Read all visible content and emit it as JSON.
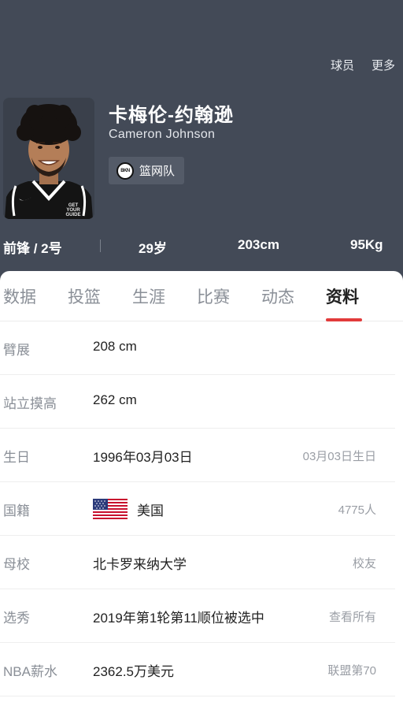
{
  "header": {
    "links": [
      "球员",
      "更多"
    ],
    "name_cn": "卡梅伦-约翰逊",
    "name_en": "Cameron Johnson",
    "team": {
      "logo_text": "BKN",
      "name": "篮网队"
    },
    "stats": {
      "position": "前锋 / 2号",
      "age": "29岁",
      "height": "203cm",
      "weight": "95Kg"
    },
    "jersey_text": "GET YOUR GUIDE"
  },
  "tabs": [
    {
      "label": "数据",
      "active": false
    },
    {
      "label": "投篮",
      "active": false
    },
    {
      "label": "生涯",
      "active": false
    },
    {
      "label": "比赛",
      "active": false
    },
    {
      "label": "动态",
      "active": false
    },
    {
      "label": "资料",
      "active": true
    }
  ],
  "profile": [
    {
      "label": "臂展",
      "value": "208 cm",
      "extra": ""
    },
    {
      "label": "站立摸高",
      "value": "262 cm",
      "extra": ""
    },
    {
      "label": "生日",
      "value": "1996年03月03日",
      "extra": "03月03日生日"
    },
    {
      "label": "国籍",
      "value": "美国",
      "extra": "4775人",
      "icon": "us-flag-icon"
    },
    {
      "label": "母校",
      "value": "北卡罗来纳大学",
      "extra": "校友"
    },
    {
      "label": "选秀",
      "value": "2019年第1轮第11顺位被选中",
      "extra": "查看所有"
    },
    {
      "label": "NBA薪水",
      "value": "2362.5万美元",
      "extra": "联盟第70"
    }
  ],
  "colors": {
    "header_bg": "#434a57",
    "accent": "#e23b3b",
    "label_gray": "#8a8f97"
  }
}
